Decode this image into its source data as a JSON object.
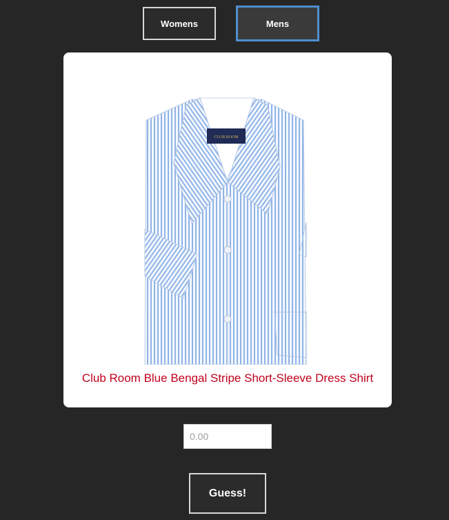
{
  "categories": {
    "womens_label": "Womens",
    "mens_label": "Mens",
    "selected": "Mens"
  },
  "product": {
    "title": "Club Room Blue Bengal Stripe Short-Sleeve Dress Shirt",
    "image_label": "blue-striped-short-sleeve-shirt",
    "brand_tag_text": "CLUB ROOM"
  },
  "guess": {
    "placeholder": "0.00",
    "button_label": "Guess!"
  },
  "colors": {
    "background": "#262626",
    "title_red": "#c0001c",
    "focus_blue": "#4f8fd0",
    "shirt_blue": "#8fb3e6"
  }
}
